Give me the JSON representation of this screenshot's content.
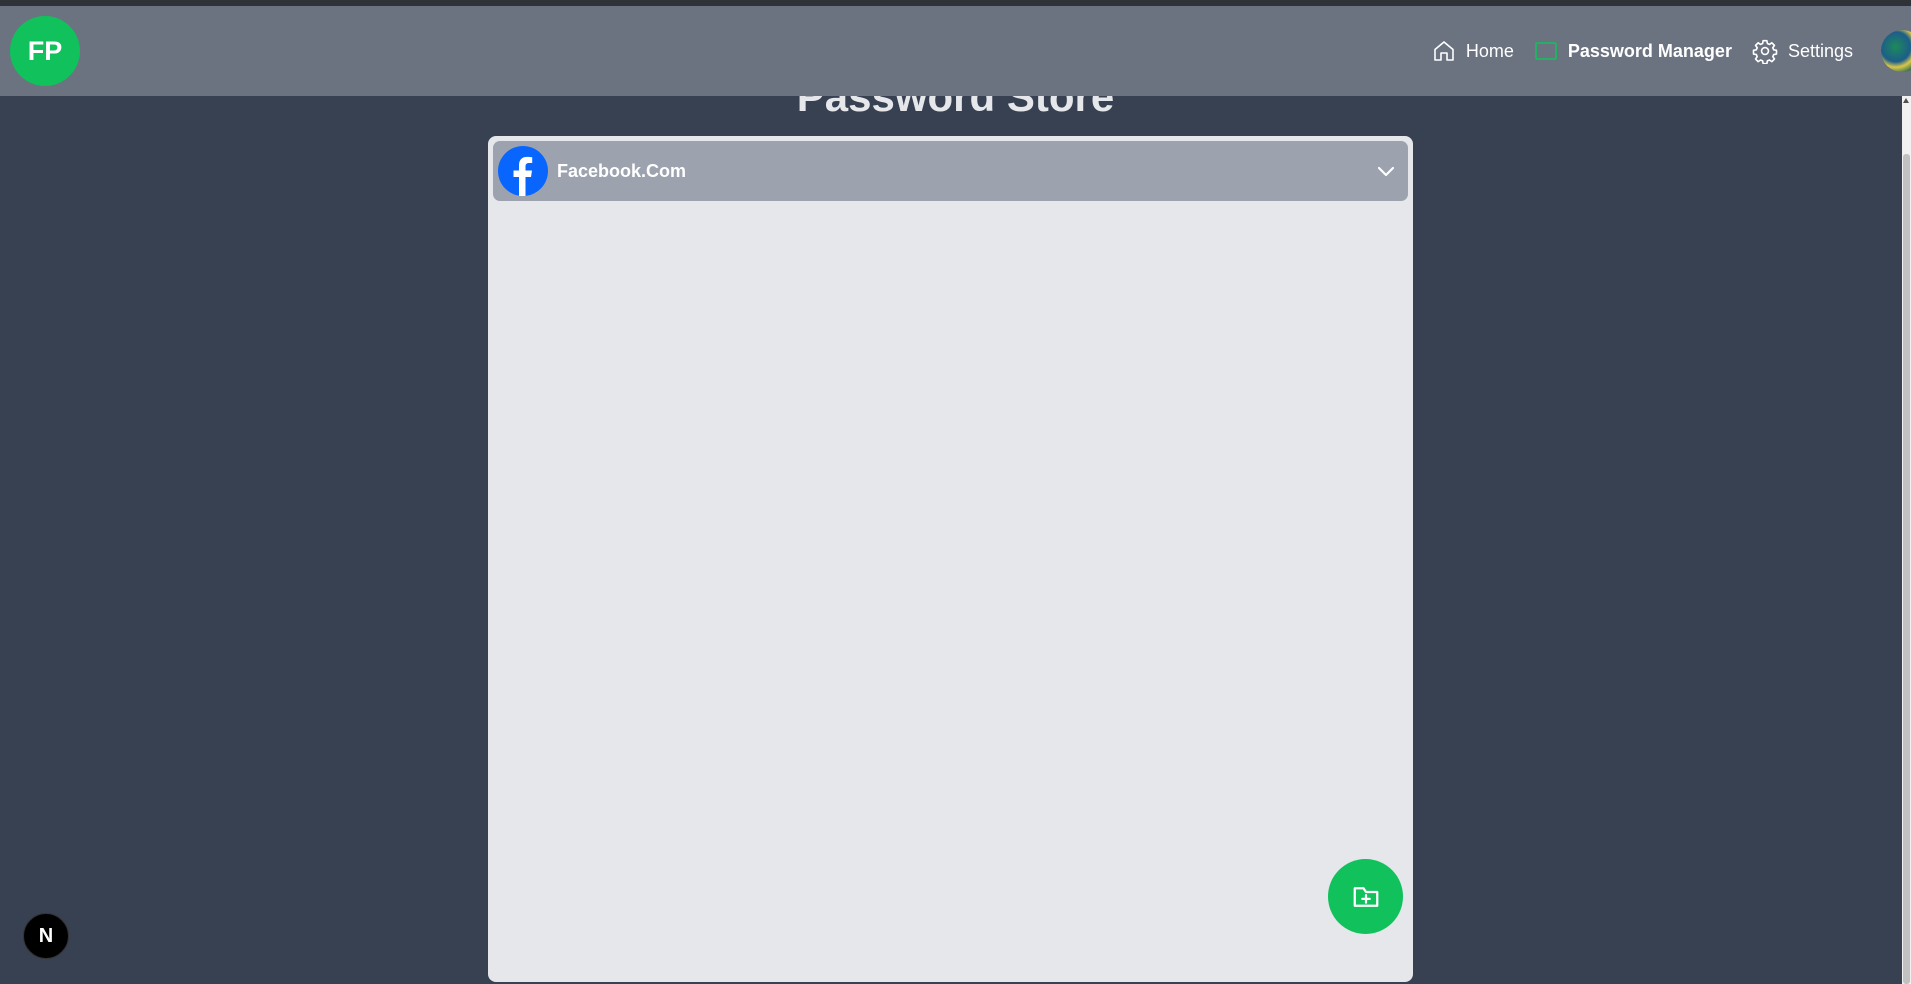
{
  "brand": {
    "logo_text": "FP"
  },
  "nav": {
    "items": [
      {
        "label": "Home",
        "icon": "home-icon"
      },
      {
        "label": "Password Manager",
        "icon": "folder-outline-icon",
        "active": true
      },
      {
        "label": "Settings",
        "icon": "gear-icon"
      }
    ],
    "avatar": "user-avatar"
  },
  "page": {
    "title": "Password Store"
  },
  "entries": [
    {
      "site": "Facebook.Com",
      "icon": "facebook-icon",
      "expanded": false
    }
  ],
  "fab": {
    "icon": "folder-plus-icon"
  },
  "dev_badge": {
    "text": "N"
  },
  "colors": {
    "background": "#374151",
    "navbar": "#6b7280",
    "accent": "#10c15c",
    "panel": "#e5e7eb",
    "entry_row": "#9ca3af",
    "facebook_blue": "#0866ff"
  }
}
